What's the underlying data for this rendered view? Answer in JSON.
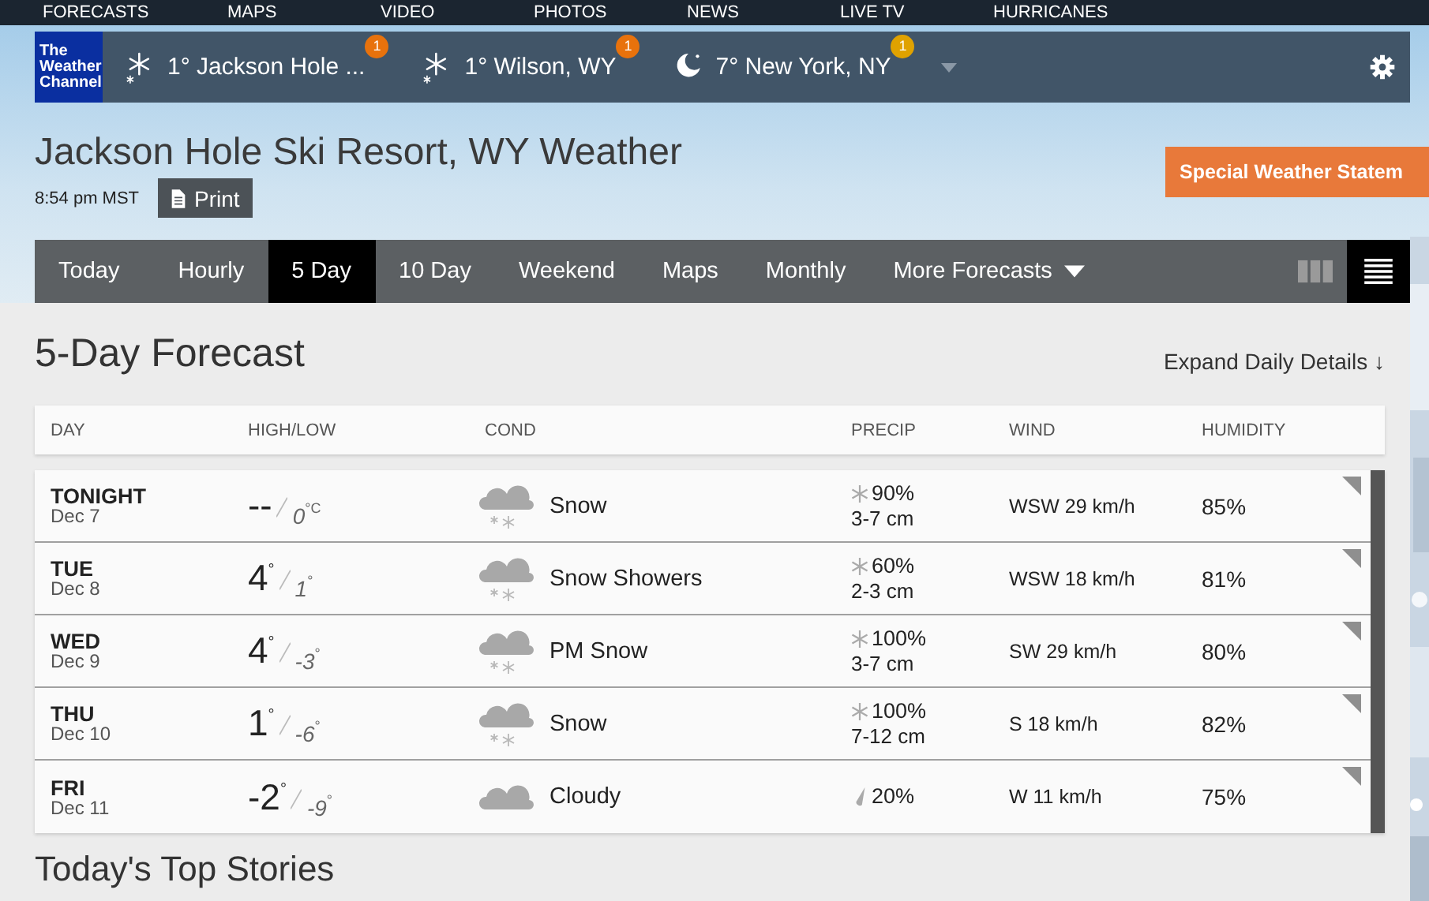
{
  "top_nav": [
    "FORECASTS",
    "MAPS",
    "VIDEO",
    "PHOTOS",
    "NEWS",
    "LIVE TV",
    "HURRICANES"
  ],
  "logo": {
    "lines": [
      "The",
      "Weather",
      "Channel"
    ]
  },
  "locations": [
    {
      "kind": "snow",
      "text": "1° Jackson Hole ...",
      "badge": "1",
      "color": "#e8720c"
    },
    {
      "kind": "snow",
      "text": "1° Wilson, WY",
      "badge": "1",
      "color": "#e8720c"
    },
    {
      "kind": "moon",
      "text": "7° New York, NY",
      "badge": "1",
      "color": "#e0a200"
    }
  ],
  "page_title": "Jackson Hole Ski Resort, WY Weather",
  "time": "8:54 pm MST",
  "print_button": "Print",
  "alert_button": "Special Weather Statem",
  "tabs": [
    {
      "label": "Today",
      "selected": false
    },
    {
      "label": "Hourly",
      "selected": false
    },
    {
      "label": "5 Day",
      "selected": true
    },
    {
      "label": "10 Day",
      "selected": false
    },
    {
      "label": "Weekend",
      "selected": false
    },
    {
      "label": "Maps",
      "selected": false
    },
    {
      "label": "Monthly",
      "selected": false
    },
    {
      "label": "More Forecasts",
      "selected": false,
      "dropdown": true
    }
  ],
  "view_toggles": [
    {
      "kind": "grid",
      "selected": false
    },
    {
      "kind": "list",
      "selected": true
    }
  ],
  "section_title": "5-Day Forecast",
  "expand_link": "Expand Daily Details ↓",
  "table": {
    "columns": [
      "DAY",
      "HIGH/LOW",
      "COND",
      "PRECIP",
      "WIND",
      "HUMIDITY"
    ],
    "rows": [
      {
        "day": "TONIGHT",
        "date": "Dec 7",
        "high": "--",
        "low": "0$^{°C}$",
        "cond": {
          "kind": "snow",
          "text": "Snow"
        },
        "precip": {
          "kind": "snow",
          "chance": "90%",
          "amount": "3-7 cm"
        },
        "wind": "WSW 29 km/h",
        "humidity": "85%"
      },
      {
        "day": "TUE",
        "date": "Dec 8",
        "high": "4$^{°}$",
        "low": "1$^{°}$",
        "cond": {
          "kind": "snow",
          "text": "Snow Showers"
        },
        "precip": {
          "kind": "snow",
          "chance": "60%",
          "amount": "2-3 cm"
        },
        "wind": "WSW 18 km/h",
        "humidity": "81%"
      },
      {
        "day": "WED",
        "date": "Dec 9",
        "high": "4$^{°}$",
        "low": "-3$^{°}$",
        "cond": {
          "kind": "snow",
          "text": "PM Snow"
        },
        "precip": {
          "kind": "snow",
          "chance": "100%",
          "amount": "3-7 cm"
        },
        "wind": "SW 29 km/h",
        "humidity": "80%"
      },
      {
        "day": "THU",
        "date": "Dec 10",
        "high": "1$^{°}$",
        "low": "-6$^{°}$",
        "cond": {
          "kind": "snow",
          "text": "Snow"
        },
        "precip": {
          "kind": "snow",
          "chance": "100%",
          "amount": "7-12 cm"
        },
        "wind": "S 18 km/h",
        "humidity": "82%"
      },
      {
        "day": "FRI",
        "date": "Dec 11",
        "high": "-2$^{°}$",
        "low": "-9$^{°}$",
        "cond": {
          "kind": "cloud",
          "text": "Cloudy"
        },
        "precip": {
          "kind": "rain",
          "chance": "20%"
        },
        "wind": "W 11 km/h",
        "humidity": "75%"
      }
    ]
  },
  "next_section_title": "Today's Top Stories"
}
